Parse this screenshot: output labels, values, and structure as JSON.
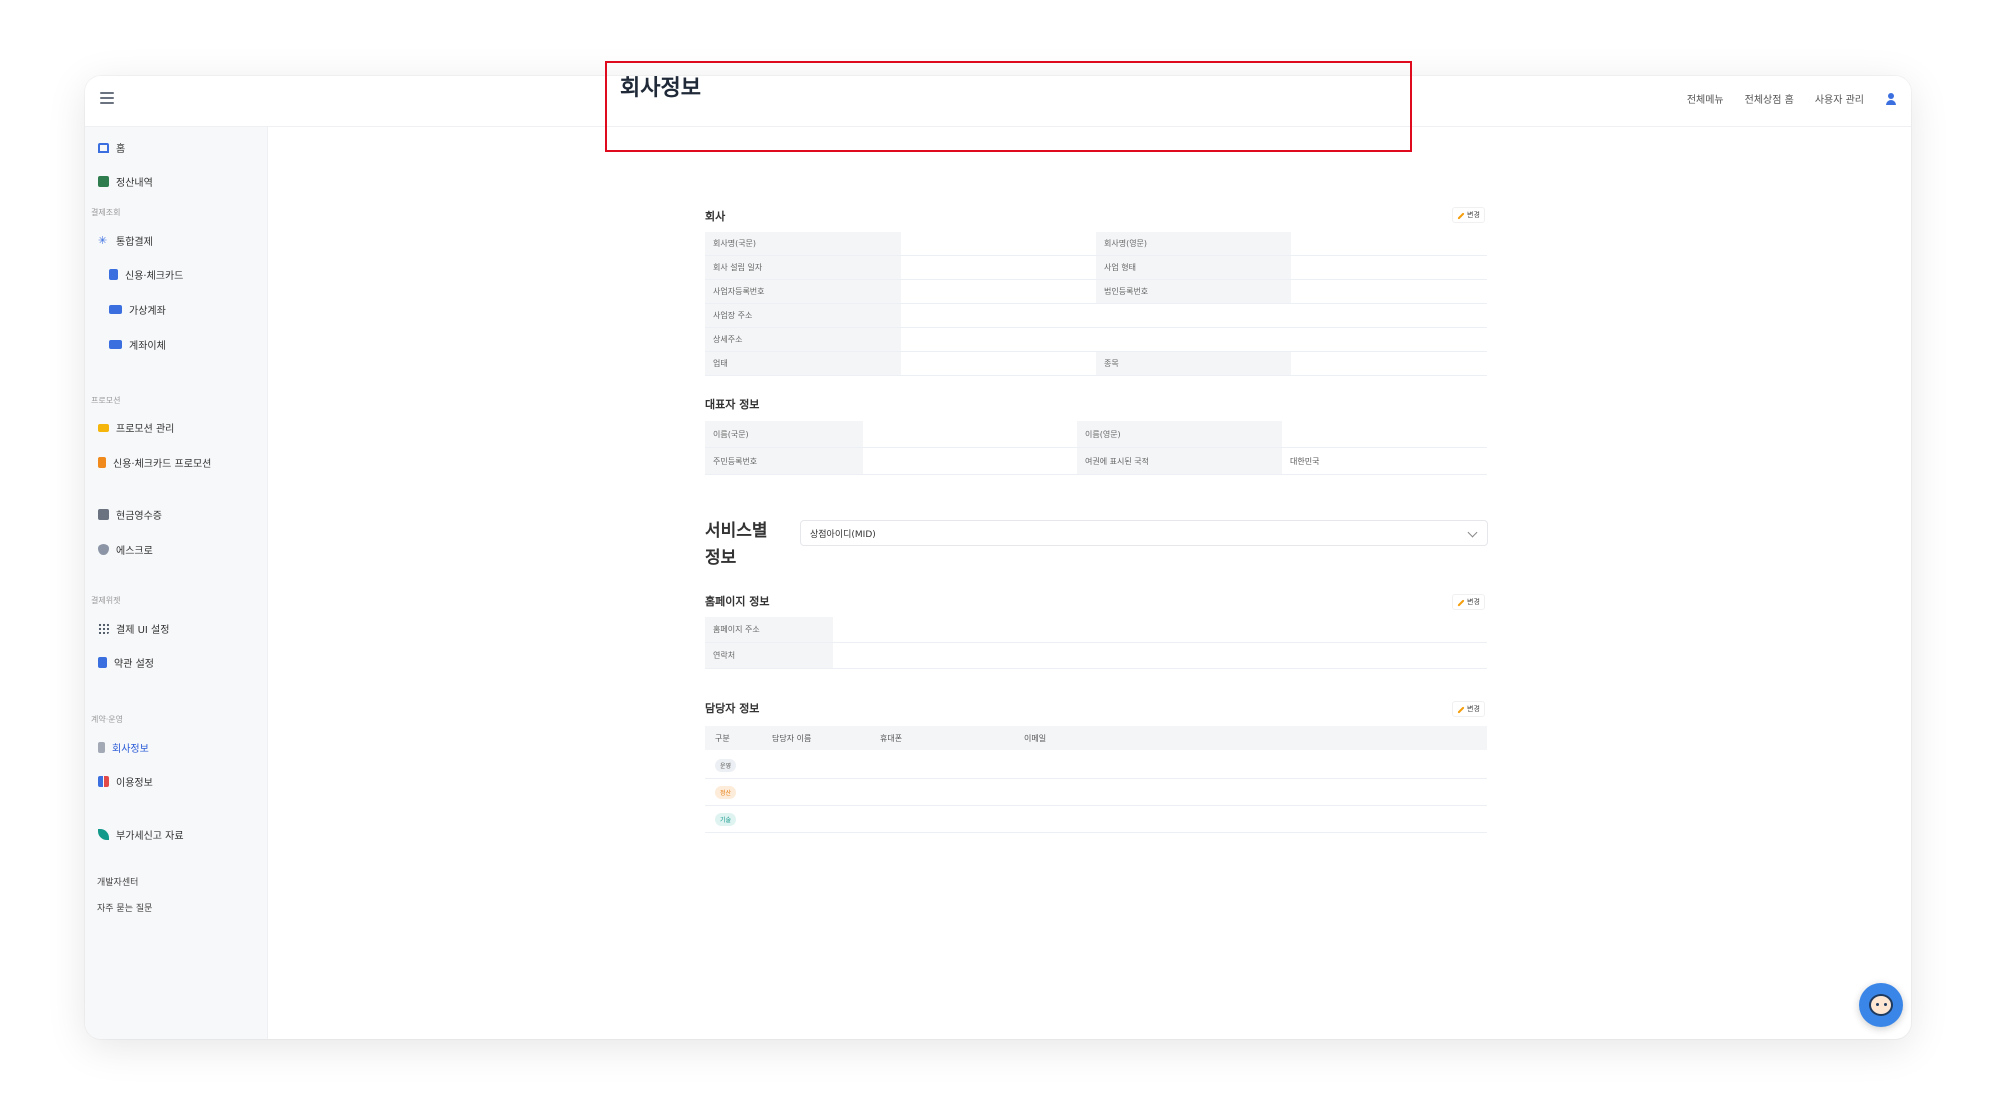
{
  "topbar": {
    "links": [
      "전체메뉴",
      "전체상점 홈",
      "사용자 관리"
    ]
  },
  "sidebar": {
    "items": [
      {
        "label": "홈",
        "icon": "home-icon"
      },
      {
        "label": "정산내역",
        "icon": "grid-icon"
      }
    ],
    "sections": [
      {
        "title": "결제조회",
        "items": [
          "통합결제",
          "신용·체크카드",
          "가상계좌",
          "계좌이체"
        ]
      },
      {
        "title": "프로모션",
        "items": [
          "프로모션 관리",
          "신용·체크카드 프로모션"
        ]
      },
      {
        "title": "",
        "items": [
          "현금영수증",
          "에스크로"
        ]
      },
      {
        "title": "결제위젯",
        "items": [
          "결제 UI 설정",
          "약관 설정"
        ]
      },
      {
        "title": "계약·운영",
        "items": [
          "회사정보",
          "이용정보"
        ]
      },
      {
        "title": "",
        "items": [
          "부가세신고 자료"
        ]
      }
    ],
    "footer": [
      "개발자센터",
      "자주 묻는 질문"
    ]
  },
  "page": {
    "title": "회사정보",
    "edit_label": "변경"
  },
  "company": {
    "title": "회사",
    "rows": [
      [
        "회사명(국문)",
        "",
        "회사명(영문)",
        ""
      ],
      [
        "회사 설립 일자",
        "",
        "사업 형태",
        ""
      ],
      [
        "사업자등록번호",
        "",
        "법인등록번호",
        ""
      ],
      [
        "사업장 주소",
        ""
      ],
      [
        "상세주소",
        ""
      ],
      [
        "업태",
        "",
        "종목",
        ""
      ]
    ]
  },
  "representative": {
    "title": "대표자 정보",
    "rows": [
      [
        "이름(국문)",
        "",
        "이름(영문)",
        ""
      ],
      [
        "주민등록번호",
        "",
        "여권에 표시된 국적",
        "대한민국"
      ]
    ]
  },
  "service": {
    "title": "서비스별 정보",
    "select_value": "상점아이디(MID)"
  },
  "homepage": {
    "title": "홈페이지 정보",
    "rows": [
      [
        "홈페이지 주소",
        ""
      ],
      [
        "연락처",
        ""
      ]
    ]
  },
  "contact": {
    "title": "담당자 정보",
    "columns": [
      "구분",
      "담당자 이름",
      "휴대폰",
      "이메일"
    ],
    "rows": [
      {
        "badge": "운영",
        "bg": "#eceff3",
        "fg": "#555555"
      },
      {
        "badge": "정산",
        "bg": "#fdecd9",
        "fg": "#e57b12"
      },
      {
        "badge": "기술",
        "bg": "#dff3f1",
        "fg": "#13998a"
      }
    ]
  },
  "colors": {
    "accent": "#2a5bd7",
    "highlight": "#e00a1e"
  }
}
